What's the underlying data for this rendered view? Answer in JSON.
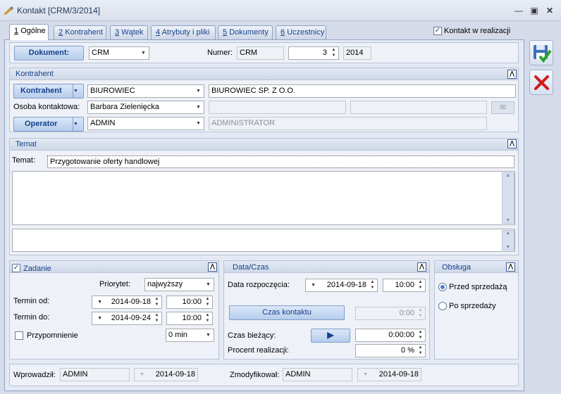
{
  "window": {
    "title": "Kontakt [CRM/3/2014]",
    "min_icon": "minimize-icon",
    "max_icon": "maximize-icon",
    "close_icon": "close-icon"
  },
  "tabs": [
    {
      "num": "1",
      "label": "Ogólne"
    },
    {
      "num": "2",
      "label": "Kontrahent"
    },
    {
      "num": "3",
      "label": "Wątek"
    },
    {
      "num": "4",
      "label": "Atrybuty i pliki"
    },
    {
      "num": "5",
      "label": "Dokumenty"
    },
    {
      "num": "6",
      "label": "Uczestnicy"
    }
  ],
  "realization": {
    "label": "Kontakt w realizacji",
    "checked": true
  },
  "document": {
    "button": "Dokument:",
    "type": "CRM",
    "numer_label": "Numer:",
    "numer_prefix": "CRM",
    "numer_value": "3",
    "year": "2014"
  },
  "kontrahent": {
    "section": "Kontrahent",
    "button": "Kontrahent",
    "code": "BIUROWIEC",
    "name": "BIUROWIEC SP. Z O.O.",
    "osoba_label": "Osoba kontaktowa:",
    "osoba": "Barbara Zielenięcka",
    "operator_button": "Operator",
    "operator_code": "ADMIN",
    "operator_name": "ADMINISTRATOR"
  },
  "temat": {
    "section": "Temat",
    "label": "Temat:",
    "value": "Przygotowanie oferty handlowej"
  },
  "zadanie": {
    "label": "Zadanie",
    "checked": true,
    "priorytet_label": "Priorytet:",
    "priorytet": "najwyższy",
    "termin_od_label": "Termin od:",
    "termin_od_date": "2014-09-18",
    "termin_od_time": "10:00",
    "termin_do_label": "Termin do:",
    "termin_do_date": "2014-09-24",
    "termin_do_time": "10:00",
    "przypomnienie_label": "Przypomnienie",
    "przypomnienie_value": "0 min"
  },
  "datacza": {
    "section": "Data/Czas",
    "start_label": "Data rozpoczęcia:",
    "start_date": "2014-09-18",
    "start_time": "10:00",
    "czas_kontaktu_button": "Czas kontaktu",
    "czas_kontaktu_value": "0:00",
    "biezacy_label": "Czas bieżący:",
    "biezacy_value": "0:00:00",
    "procent_label": "Procent realizacji:",
    "procent_value": "0 %"
  },
  "obsluga": {
    "section": "Obsługa",
    "przed": "Przed sprzedażą",
    "po": "Po sprzedaży"
  },
  "footer": {
    "wprowadzil_label": "Wprowadził:",
    "wprowadzil": "ADMIN",
    "wprowadzil_date": "2014-09-18",
    "zmodyfikowal_label": "Zmodyfikował:",
    "zmodyfikowal": "ADMIN",
    "zmodyfikowal_date": "2014-09-18"
  },
  "side": {
    "save_icon": "save-check-icon",
    "cancel_icon": "cancel-x-icon"
  }
}
